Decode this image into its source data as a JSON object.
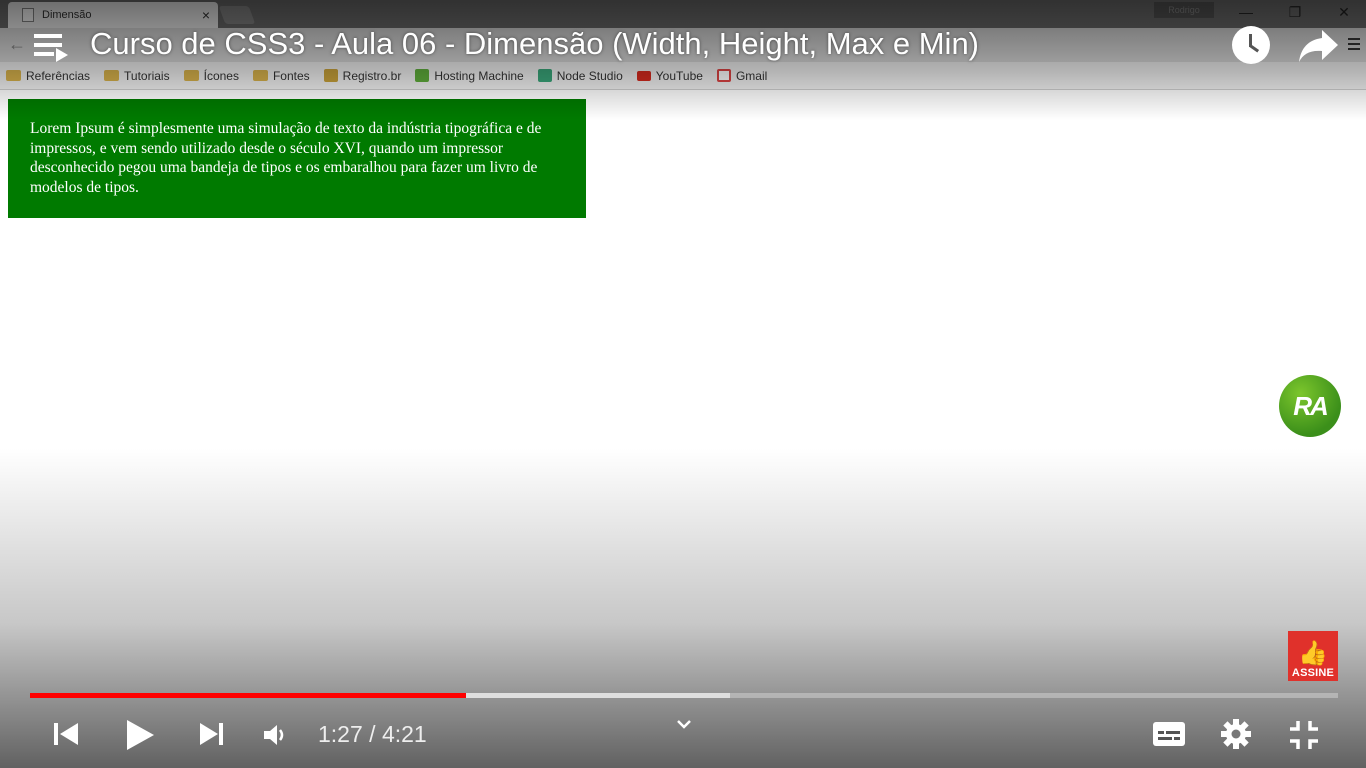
{
  "browser": {
    "tab_title": "Dimensão",
    "tab_close": "×",
    "user_chip": "Rodrigo",
    "window_controls": [
      "—",
      "❐",
      "✕"
    ],
    "back": "←",
    "bookmarks": [
      {
        "label": "Referências",
        "icon": "folder-icon"
      },
      {
        "label": "Tutoriais",
        "icon": "folder-icon"
      },
      {
        "label": "Ícones",
        "icon": "folder-icon"
      },
      {
        "label": "Fontes",
        "icon": "folder-icon"
      },
      {
        "label": "Registro.br",
        "icon": "registro-icon"
      },
      {
        "label": "Hosting Machine",
        "icon": "hosting-icon"
      },
      {
        "label": "Node Studio",
        "icon": "node-icon"
      },
      {
        "label": "YouTube",
        "icon": "youtube-icon"
      },
      {
        "label": "Gmail",
        "icon": "gmail-icon"
      }
    ],
    "lorem_text": "Lorem Ipsum é simplesmente uma simulação de texto da indústria tipográfica e de impressos, e vem sendo utilizado desde o século XVI, quando um impressor desconhecido pegou uma bandeja de tipos e os embaralhou para fazer um livro de modelos de tipos."
  },
  "player": {
    "title": "Curso de CSS3 - Aula 06 - Dimensão (Width, Height, Max e Min)",
    "current_time": "1:27",
    "duration": "4:21",
    "time_separator": "/",
    "played_fraction": 0.333,
    "buffered_fraction": 0.535,
    "ra_logo_text": "RA",
    "subscribe_text": "ASSINE",
    "colors": {
      "progress": "#ff0000",
      "lorem_bg": "#007a00",
      "subscribe_bg": "#e0312b"
    }
  }
}
